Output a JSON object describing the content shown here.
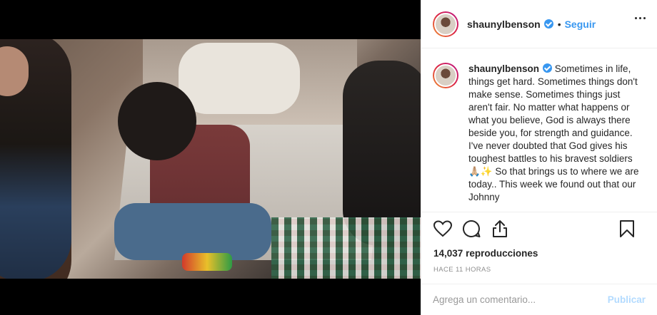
{
  "post": {
    "username": "shaunylbenson",
    "follow_label": "Seguir",
    "dot": "•",
    "caption": "Sometimes in life, things get hard. Sometimes things don't make sense. Sometimes things just aren't fair. No matter what happens or what you believe, God is always there beside you, for strength and guidance. I've never doubted that God gives his toughest battles to his bravest soldiers 🙏🏼✨ So that brings us to where we are today.. This week we found out that our Johnny",
    "views_count": "14,037",
    "views_label": "reproducciones",
    "timestamp": "HACE 11 HORAS"
  },
  "comment": {
    "placeholder": "Agrega un comentario...",
    "post_label": "Publicar"
  },
  "icons": {
    "like": "heart-icon",
    "comment": "comment-icon",
    "share": "share-icon",
    "save": "bookmark-icon",
    "more": "more-options-icon",
    "verified": "verified-badge-icon"
  },
  "colors": {
    "link_blue": "#3897f0",
    "post_disabled": "#b3dbff",
    "muted": "#8e8e8e"
  }
}
